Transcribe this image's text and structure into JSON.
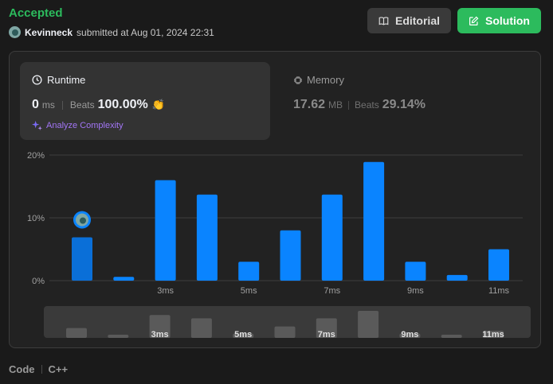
{
  "header": {
    "status": "Accepted",
    "user": "Kevinneck",
    "submitted_text": "submitted at Aug 01, 2024 22:31"
  },
  "buttons": {
    "editorial": "Editorial",
    "solution": "Solution"
  },
  "runtime": {
    "title": "Runtime",
    "value": "0",
    "unit": "ms",
    "beats_label": "Beats",
    "beats_pct": "100.00%",
    "analyze": "Analyze Complexity"
  },
  "memory": {
    "title": "Memory",
    "value": "17.62",
    "unit": "MB",
    "beats_label": "Beats",
    "beats_pct": "29.14%"
  },
  "footer": {
    "code_label": "Code",
    "language": "C++"
  },
  "colors": {
    "accent_green": "#2cbb5d",
    "bar_blue": "#0a84ff",
    "bar_selected": "#0a6fd8",
    "purple": "#a275f5"
  },
  "chart_data": {
    "type": "bar",
    "ylim": [
      0,
      20
    ],
    "yticks": [
      "0%",
      "10%",
      "20%"
    ],
    "xtick_labels": [
      "3ms",
      "5ms",
      "7ms",
      "9ms",
      "11ms"
    ],
    "xtick_positions": [
      2,
      4,
      6,
      8,
      10
    ],
    "values": [
      6.9,
      0.6,
      16.0,
      13.7,
      3.0,
      8.0,
      13.7,
      18.9,
      3.0,
      0.9,
      5.0
    ],
    "selected_index": 0,
    "overview_tick_labels": [
      "3ms",
      "5ms",
      "7ms",
      "9ms",
      "11ms"
    ]
  }
}
